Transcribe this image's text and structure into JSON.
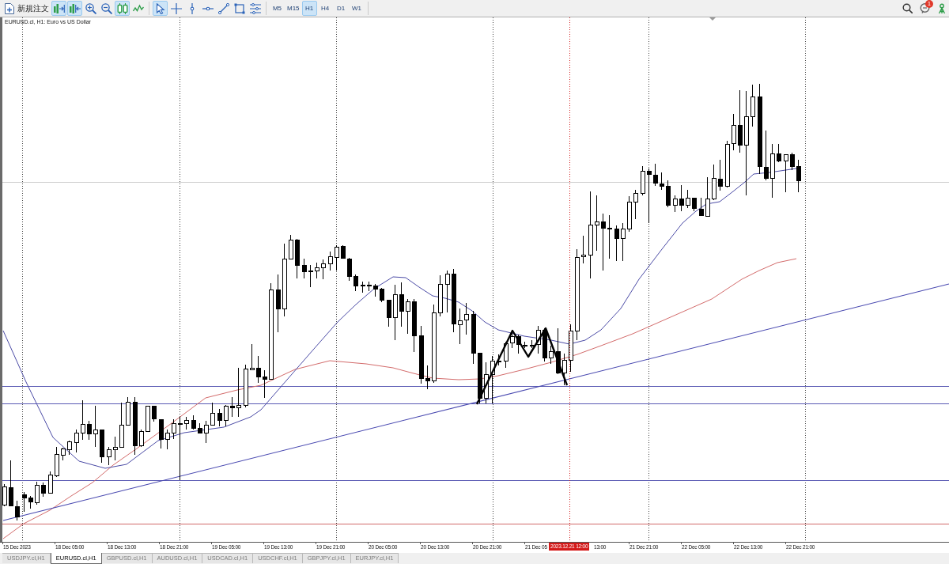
{
  "toolbar": {
    "new_order_button": {
      "label": "新規注文"
    },
    "chart_tools": [
      {
        "kind": "autoscroll",
        "on": true
      },
      {
        "kind": "shift",
        "on": true
      },
      {
        "kind": "zoomin",
        "on": false
      },
      {
        "kind": "zoomout",
        "on": false
      },
      {
        "kind": "candles",
        "on": true
      },
      {
        "kind": "indicators",
        "on": false
      }
    ],
    "drawing_tools": [
      {
        "kind": "cursor",
        "selected": true
      },
      {
        "kind": "crosshair",
        "selected": false
      },
      {
        "kind": "vline",
        "selected": false
      },
      {
        "kind": "hline",
        "selected": false
      },
      {
        "kind": "trendline",
        "selected": false
      },
      {
        "kind": "rectangle",
        "selected": false
      },
      {
        "kind": "objects",
        "selected": false
      }
    ],
    "timeframes": [
      {
        "label": "M5",
        "selected": false
      },
      {
        "label": "M15",
        "selected": false
      },
      {
        "label": "H1",
        "selected": true
      },
      {
        "label": "H4",
        "selected": false
      },
      {
        "label": "D1",
        "selected": false
      },
      {
        "label": "W1",
        "selected": false
      }
    ],
    "notifications": {
      "badge": "1"
    }
  },
  "chart": {
    "title": "EURUSD.cl, H1: Euro vs US Dollar",
    "time_axis": {
      "labels": [
        "15 Dec 2023",
        "18 Dec 05:00",
        "18 Dec 13:00",
        "18 Dec 21:00",
        "19 Dec 05:00",
        "19 Dec 13:00",
        "19 Dec 21:00",
        "20 Dec 05:00",
        "20 Dec 13:00",
        "20 Dec 21:00",
        "21 Dec 05",
        "13:00",
        "21 Dec 21:00",
        "22 Dec 05:00",
        "22 Dec 13:00",
        "22 Dec 21:00"
      ],
      "cursor_time": "2023.12.21 12:00"
    }
  },
  "tabs": [
    {
      "label": "USDJPY.cl,H1",
      "selected": false
    },
    {
      "label": "EURUSD.cl,H1",
      "selected": true
    },
    {
      "label": "GBPUSD.cl,H1",
      "selected": false
    },
    {
      "label": "AUDUSD.cl,H1",
      "selected": false
    },
    {
      "label": "USDCAD.cl,H1",
      "selected": false
    },
    {
      "label": "USDCHF.cl,H1",
      "selected": false
    },
    {
      "label": "GBPJPY.cl,H1",
      "selected": false
    },
    {
      "label": "EURJPY.cl,H1",
      "selected": false
    }
  ]
}
